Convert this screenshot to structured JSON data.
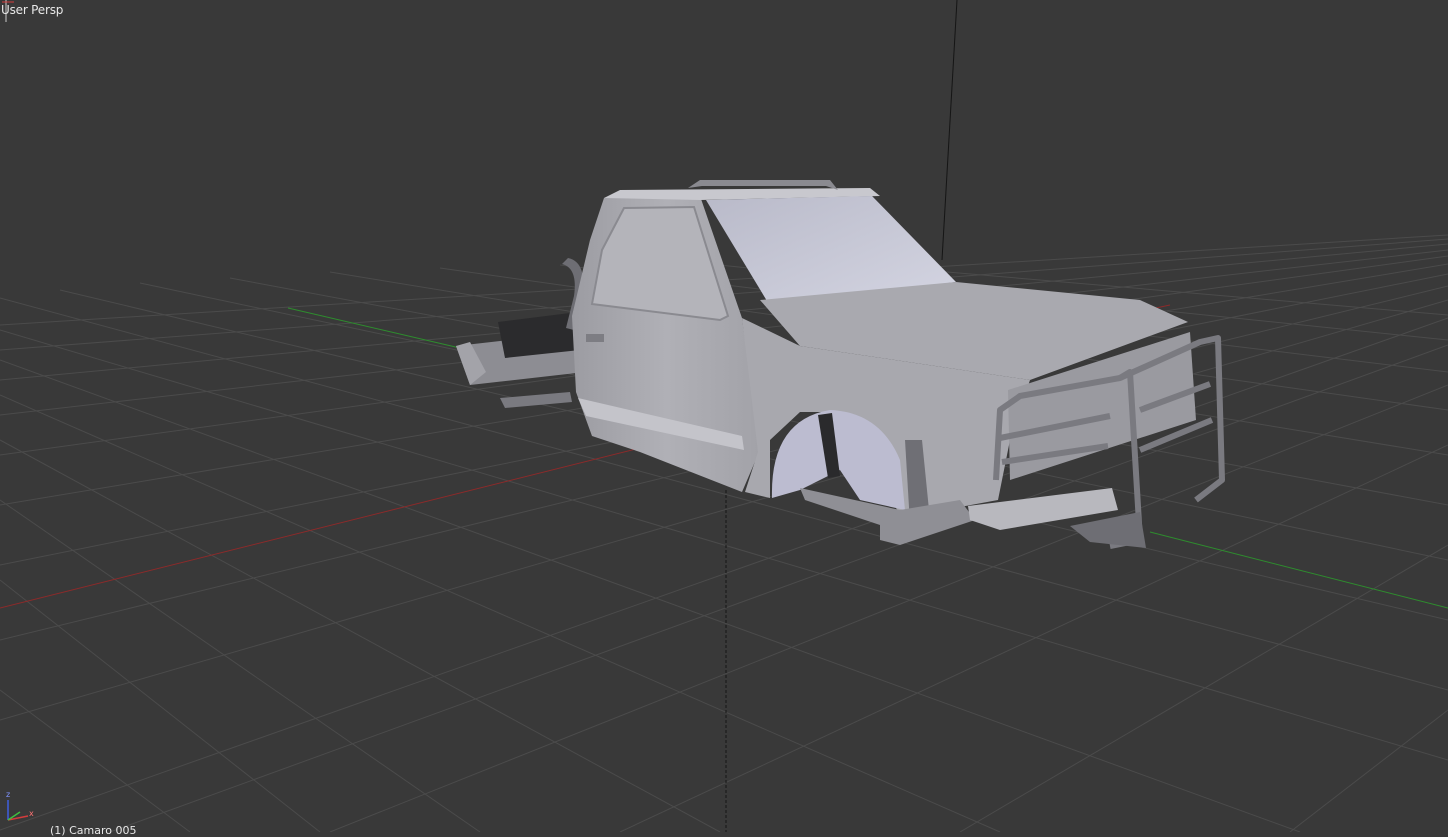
{
  "viewport": {
    "view_label": "User Persp",
    "object_label": "(1) Camaro 005",
    "background_color": "#393939",
    "grid_color": "#4a4a4a",
    "x_axis_color": "#8c2a2a",
    "y_axis_color": "#2e8c2e",
    "z_axis_color": "#111111"
  },
  "gizmo": {
    "x_label": "x",
    "z_label": "z",
    "x_color": "#d33c3c",
    "y_color": "#3fbf3f",
    "z_color": "#3f5fdf"
  },
  "model": {
    "description_icon": "pickup-truck-model",
    "body_color": "#b7b7bd"
  }
}
